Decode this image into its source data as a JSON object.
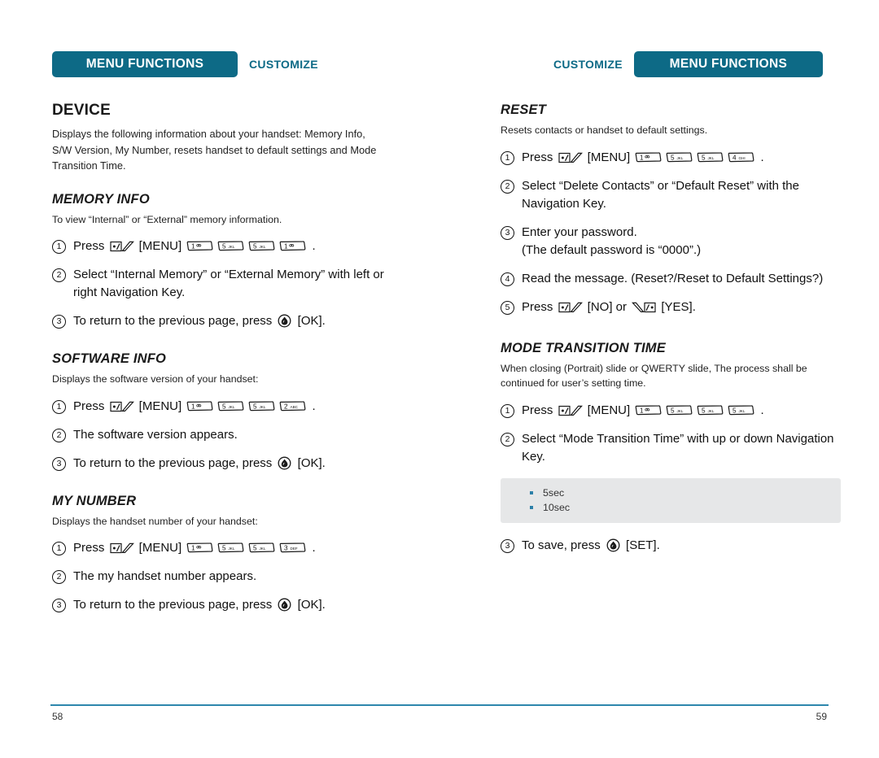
{
  "left_page": {
    "header": {
      "banner": "MENU FUNCTIONS",
      "secondary": "CUSTOMIZE"
    },
    "page_number": "58",
    "section_title": "DEVICE",
    "section_desc": "Displays the following information about your handset: Memory Info, S/W Version, My Number, resets handset to default settings and Mode Transition Time.",
    "subsections": [
      {
        "title": "MEMORY INFO",
        "desc": "To view “Internal” or “External” memory information.",
        "steps": [
          {
            "num": "1",
            "pre": "Press",
            "softkey": "menu-softkey",
            "mid": "[MENU]",
            "keys": [
              "1",
              "5",
              "5",
              "1"
            ],
            "post": "."
          },
          {
            "num": "2",
            "text": "Select “Internal Memory” or “External Memory” with left or right Navigation Key."
          },
          {
            "num": "3",
            "pre": "To return to the previous page, press",
            "okkey": "ok-key",
            "post": "[OK]."
          }
        ]
      },
      {
        "title": "SOFTWARE INFO",
        "desc": "Displays the software version of your handset:",
        "steps": [
          {
            "num": "1",
            "pre": "Press",
            "softkey": "menu-softkey",
            "mid": "[MENU]",
            "keys": [
              "1",
              "5",
              "5",
              "2"
            ],
            "post": "."
          },
          {
            "num": "2",
            "text": "The software version appears."
          },
          {
            "num": "3",
            "pre": "To return to the previous page, press",
            "okkey": "ok-key",
            "post": "[OK]."
          }
        ]
      },
      {
        "title": "MY NUMBER",
        "desc": "Displays the handset number of your handset:",
        "steps": [
          {
            "num": "1",
            "pre": "Press",
            "softkey": "menu-softkey",
            "mid": "[MENU]",
            "keys": [
              "1",
              "5",
              "5",
              "3"
            ],
            "post": "."
          },
          {
            "num": "2",
            "text": "The my handset number appears."
          },
          {
            "num": "3",
            "pre": "To return to the previous page, press",
            "okkey": "ok-key",
            "post": "[OK]."
          }
        ]
      }
    ]
  },
  "right_page": {
    "header": {
      "banner": "MENU FUNCTIONS",
      "secondary": "CUSTOMIZE"
    },
    "page_number": "59",
    "subsections": [
      {
        "title": "RESET",
        "desc": "Resets contacts or handset to default settings.",
        "steps": [
          {
            "num": "1",
            "pre": "Press",
            "softkey": "menu-softkey",
            "mid": "[MENU]",
            "keys": [
              "1",
              "5",
              "5",
              "4"
            ],
            "post": "."
          },
          {
            "num": "2",
            "text": "Select “Delete Contacts” or “Default Reset” with the Navigation Key."
          },
          {
            "num": "3",
            "text": "Enter your password.\n(The default password is “0000”.)"
          },
          {
            "num": "4",
            "text": "Read the message. (Reset?/Reset to Default Settings?)"
          },
          {
            "num": "5",
            "pre": "Press",
            "softkey": "left-softkey",
            "mid": "[NO] or",
            "softkey2": "right-softkey",
            "post": "[YES]."
          }
        ]
      },
      {
        "title": "MODE TRANSITION TIME",
        "desc": "When closing (Portrait) slide or QWERTY slide, The process shall be continued for user’s setting time.",
        "steps": [
          {
            "num": "1",
            "pre": "Press",
            "softkey": "menu-softkey",
            "mid": "[MENU]",
            "keys": [
              "1",
              "5",
              "5",
              "5"
            ],
            "post": "."
          },
          {
            "num": "2",
            "text": "Select “Mode Transition Time” with up or down Navigation Key."
          }
        ],
        "options": [
          "5sec",
          "10sec"
        ],
        "final_step": {
          "num": "3",
          "pre": "To save, press",
          "okkey": "ok-key",
          "post": "[SET]."
        }
      }
    ]
  },
  "keypad_legend": {
    "1": {
      "digit": "1",
      "sub": "voicemail-glyph"
    },
    "2": {
      "digit": "2",
      "sub": "ABC"
    },
    "3": {
      "digit": "3",
      "sub": "DEF"
    },
    "4": {
      "digit": "4",
      "sub": "GHI"
    },
    "5": {
      "digit": "5",
      "sub": "JKL"
    }
  },
  "colors": {
    "banner_teal": "#0d6a86",
    "rule_teal": "#2d87ad",
    "bullet_blue": "#2c7fa8",
    "option_box_gray": "#e6e7e8"
  }
}
